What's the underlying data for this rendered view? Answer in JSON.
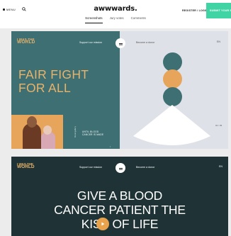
{
  "header": {
    "menu_label": "MENU",
    "logo": "awwwards.",
    "register_label": "REGISTER / LOGIN",
    "submit_label": "SUBMIT YOUR S"
  },
  "tabs": [
    {
      "label": "Screenshots",
      "active": true
    },
    {
      "label": "Jury votes",
      "active": false
    },
    {
      "label": "Comments",
      "active": false
    }
  ],
  "screenshot1": {
    "brand_line1": "I WAS THE",
    "brand_line2": "WORLD",
    "support": "Support our mission",
    "donor": "Become a donor",
    "globe": "EN",
    "headline_line1": "FAIR FIGHT",
    "headline_line2": "FOR ALL",
    "side_label": "blood gallery",
    "until_line1": "UNTIL BLOOD",
    "until_line2": "CANCER IS MADE",
    "slash": "/",
    "counter": "01 / 03"
  },
  "screenshot2": {
    "brand_line1": "I WAS THE",
    "brand_line2": "WORLD",
    "support": "Support our mission",
    "donor": "Become a donor",
    "globe": "EN",
    "headline_line1": "GIVE A BLOOD",
    "headline_line2": "CANCER PATIENT THE",
    "headline_line3": "KISS OF LIFE"
  },
  "colors": {
    "teal": "#3e6f73",
    "orange": "#e6a55b",
    "accent_green": "#40d3a4",
    "dark": "#1f3336"
  }
}
